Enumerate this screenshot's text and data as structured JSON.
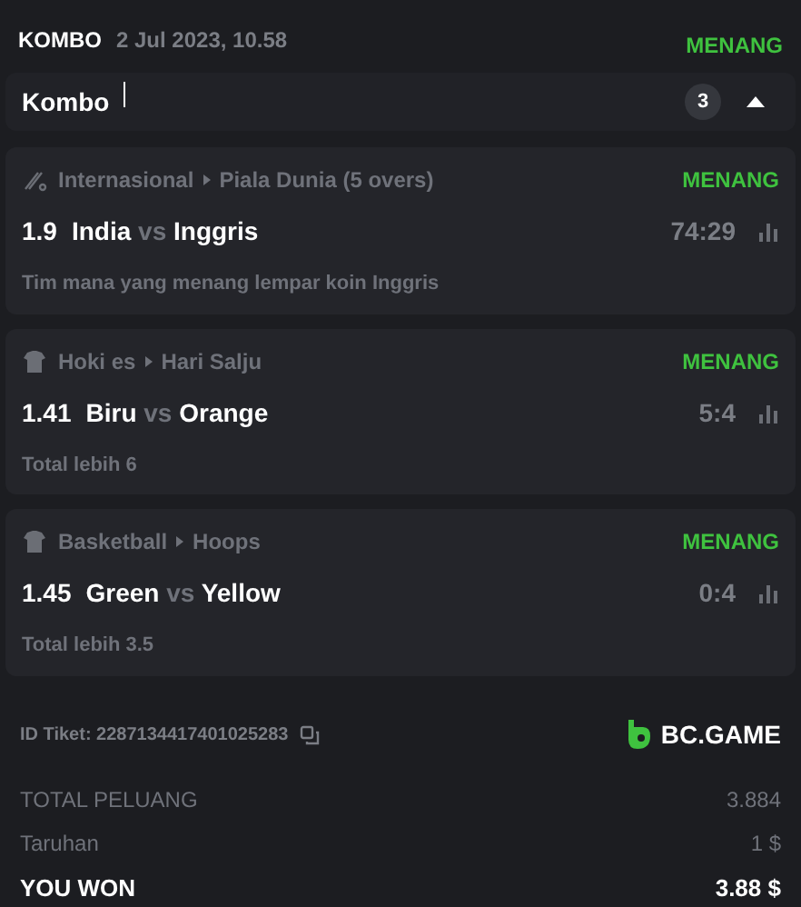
{
  "header": {
    "type": "KOMBO",
    "date": "2 Jul 2023, 10.58",
    "status": "MENANG"
  },
  "combo": {
    "title": "Kombo",
    "count": "3",
    "expanded": true
  },
  "legs": [
    {
      "kind": "cricket",
      "category": "Internasional",
      "league": "Piala Dunia (5 overs)",
      "status": "MENANG",
      "odds": "1.9",
      "home": "India",
      "vs": "vs",
      "away": "Inggris",
      "score": "74:29",
      "market": "Tim mana yang menang lempar koin Inggris"
    },
    {
      "kind": "team",
      "category": "Hoki es",
      "league": "Hari Salju",
      "status": "MENANG",
      "odds": "1.41",
      "home": "Biru",
      "vs": "vs",
      "away": "Orange",
      "score": "5:4",
      "market": "Total lebih 6"
    },
    {
      "kind": "team",
      "category": "Basketball",
      "league": "Hoops",
      "status": "MENANG",
      "odds": "1.45",
      "home": "Green",
      "vs": "vs",
      "away": "Yellow",
      "score": "0:4",
      "market": "Total lebih 3.5"
    }
  ],
  "ticket": {
    "id_label": "ID Tiket: 2287134417401025283",
    "brand": "BC.GAME"
  },
  "summary": [
    {
      "kind": "muted",
      "label": "TOTAL PELUANG",
      "value": "3.884"
    },
    {
      "kind": "muted",
      "label": "Taruhan",
      "value": "1 $"
    },
    {
      "kind": "total",
      "label": "YOU WON",
      "value": "3.88 $"
    }
  ]
}
